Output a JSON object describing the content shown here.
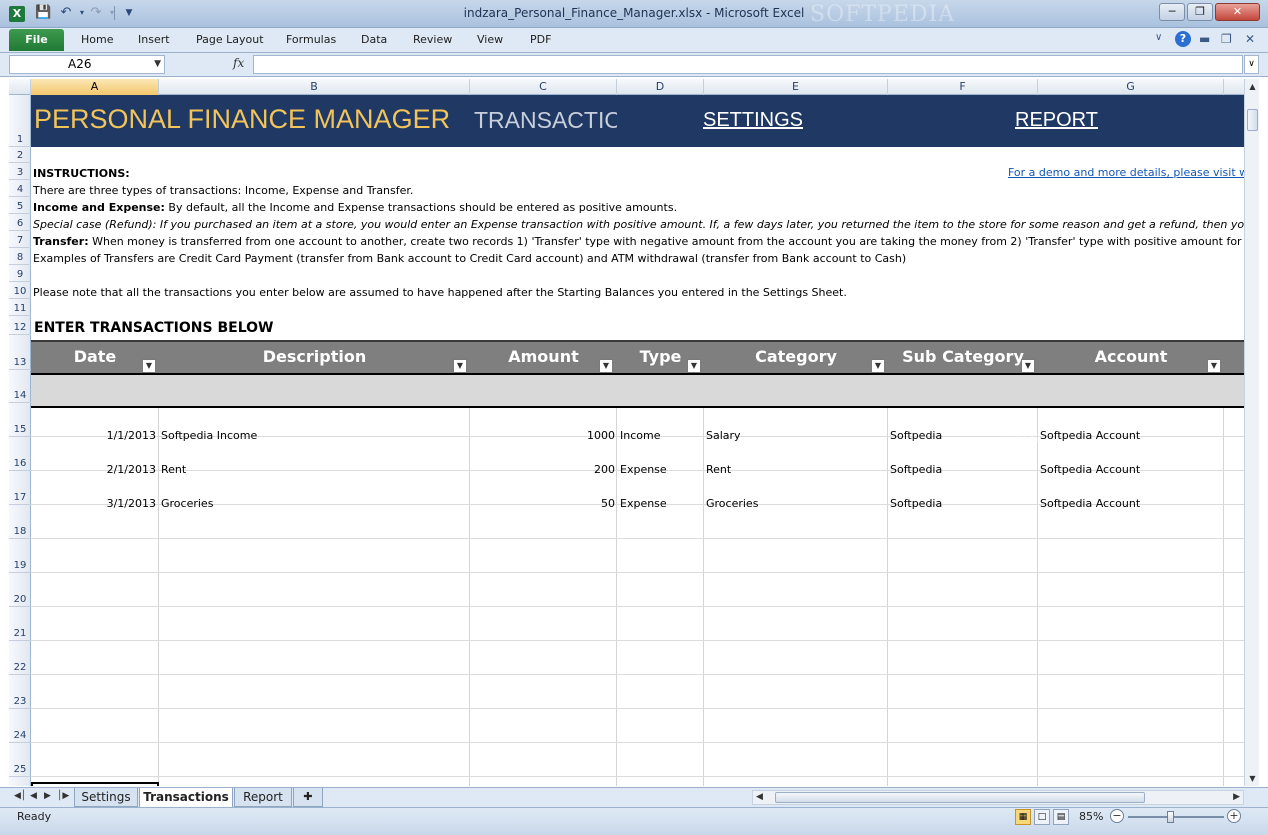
{
  "window": {
    "title": "indzara_Personal_Finance_Manager.xlsx  -  Microsoft Excel",
    "app_icon": "X",
    "watermark": "SOFTPEDIA"
  },
  "quick_access": {
    "save_icon": "save-icon",
    "undo_icon": "undo-icon",
    "redo_icon": "redo-icon",
    "customize_icon": "customize-qat-icon"
  },
  "ribbon": {
    "file_label": "File",
    "tabs": [
      "Home",
      "Insert",
      "Page Layout",
      "Formulas",
      "Data",
      "Review",
      "View",
      "PDF"
    ],
    "help_label": "?"
  },
  "formula_bar": {
    "name_box": "A26",
    "fx_label": "fx",
    "formula": ""
  },
  "columns": [
    "A",
    "B",
    "C",
    "D",
    "E",
    "F",
    "G"
  ],
  "active_column": "A",
  "rows": [
    "1",
    "2",
    "3",
    "4",
    "5",
    "6",
    "7",
    "8",
    "9",
    "10",
    "11",
    "12",
    "13",
    "14",
    "15",
    "16",
    "17",
    "18",
    "19",
    "20",
    "21",
    "22",
    "23",
    "24",
    "25"
  ],
  "banner": {
    "title": "PERSONAL FINANCE MANAGER",
    "current_tab": "TRANSACTIONS",
    "settings_link": "SETTINGS",
    "report_link": "REPORT"
  },
  "instructions": {
    "heading": "INSTRUCTIONS:",
    "demo_link": "For a demo and more details, please visit www.indzara.com",
    "line4": "There are three types of transactions: Income, Expense and Transfer.",
    "line5_bold": "Income and Expense:",
    "line5_rest": " By default, all the Income and Expense transactions should be entered as positive amounts.",
    "line6": "Special case (Refund): If you purchased an item at a store, you would enter an Expense transaction with positive amount. If, a few days later, you returned the item to the store for some reason and get a refund, then you should enter the refund as",
    "line7_bold": "Transfer:",
    "line7_rest": " When money is transferred from one account to another, create two records 1) 'Transfer' type with negative amount from the account you are taking the money from 2) 'Transfer' type with positive amount for the account",
    "line8": "Examples of Transfers are Credit Card Payment (transfer from Bank account to Credit Card account) and ATM withdrawal (transfer from Bank account to Cash)",
    "line10": "Please note that all the transactions you enter below are assumed to have happened after the Starting Balances you entered in the Settings Sheet."
  },
  "table": {
    "heading": "ENTER TRANSACTIONS BELOW",
    "headers": [
      "Date",
      "Description",
      "Amount",
      "Type",
      "Category",
      "Sub Category",
      "Account"
    ],
    "rows": [
      [
        "1/1/2013",
        "Softpedia Income",
        "1000",
        "Income",
        "Salary",
        "Softpedia",
        "Softpedia Account"
      ],
      [
        "2/1/2013",
        "Rent",
        "200",
        "Expense",
        "Rent",
        "Softpedia",
        "Softpedia Account"
      ],
      [
        "3/1/2013",
        "Groceries",
        "50",
        "Expense",
        "Groceries",
        "Softpedia",
        "Softpedia Account"
      ]
    ]
  },
  "sheet_tabs": [
    "Settings",
    "Transactions",
    "Report"
  ],
  "active_sheet": "Transactions",
  "status": {
    "text": "Ready",
    "zoom": "85%",
    "zoom_fraction": 0.45
  }
}
